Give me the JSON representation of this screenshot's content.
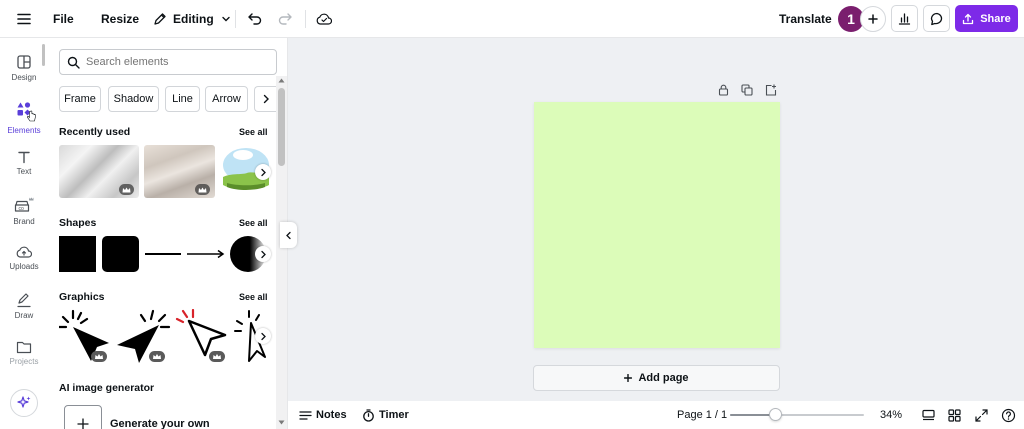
{
  "topbar": {
    "file_label": "File",
    "resize_label": "Resize",
    "editing_label": "Editing",
    "translate_label": "Translate",
    "avatar_initial": "1",
    "share_label": "Share",
    "accent_color": "#7d2ae8"
  },
  "rail": {
    "items": [
      {
        "label": "Design",
        "icon": "design-icon"
      },
      {
        "label": "Elements",
        "icon": "elements-icon"
      },
      {
        "label": "Text",
        "icon": "text-icon"
      },
      {
        "label": "Brand",
        "icon": "brand-icon"
      },
      {
        "label": "Uploads",
        "icon": "uploads-icon"
      },
      {
        "label": "Draw",
        "icon": "draw-icon"
      },
      {
        "label": "Projects",
        "icon": "projects-icon"
      }
    ]
  },
  "panel": {
    "search_placeholder": "Search elements",
    "chips": [
      "Frame",
      "Shadow",
      "Line",
      "Arrow"
    ],
    "recently_used_title": "Recently used",
    "shapes_title": "Shapes",
    "graphics_title": "Graphics",
    "ai_title": "AI image generator",
    "see_all": "See all",
    "generate_label": "Generate your own"
  },
  "canvas": {
    "page_color": "#dcfcb9",
    "add_page_label": "Add page"
  },
  "bottombar": {
    "notes_label": "Notes",
    "timer_label": "Timer",
    "page_indicator": "Page 1 / 1",
    "zoom_label": "34%",
    "zoom_fraction": 0.34
  }
}
